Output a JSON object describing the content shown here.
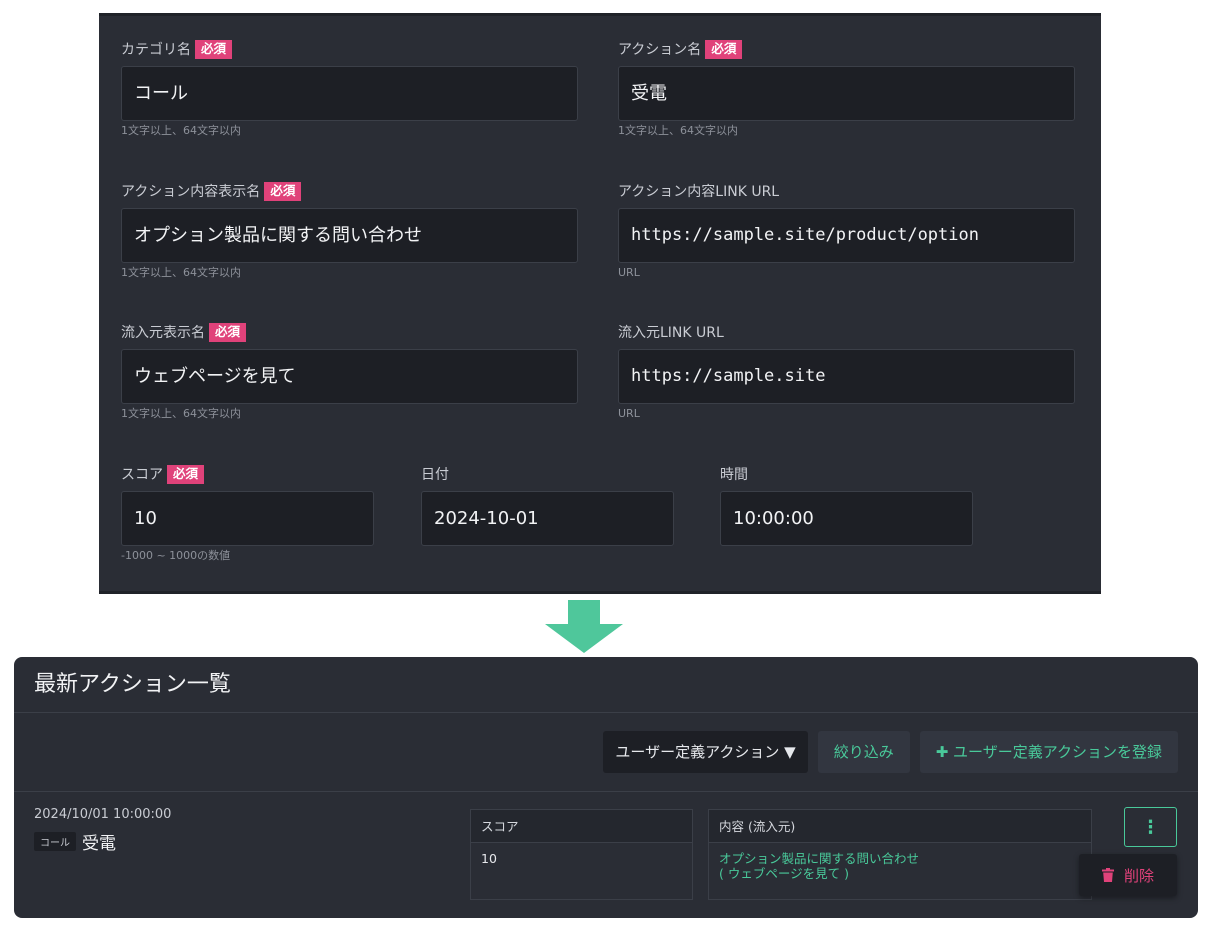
{
  "form": {
    "category": {
      "label": "カテゴリ名",
      "required": "必須",
      "value": "コール",
      "hint": "1文字以上、64文字以内"
    },
    "action": {
      "label": "アクション名",
      "required": "必須",
      "value": "受電",
      "hint": "1文字以上、64文字以内"
    },
    "content_name": {
      "label": "アクション内容表示名",
      "required": "必須",
      "value": "オプション製品に関する問い合わせ",
      "hint": "1文字以上、64文字以内"
    },
    "content_url": {
      "label": "アクション内容LINK URL",
      "value": "https://sample.site/product/option",
      "hint": "URL"
    },
    "source_name": {
      "label": "流入元表示名",
      "required": "必須",
      "value": "ウェブページを見て",
      "hint": "1文字以上、64文字以内"
    },
    "source_url": {
      "label": "流入元LINK URL",
      "value": "https://sample.site",
      "hint": "URL"
    },
    "score": {
      "label": "スコア",
      "required": "必須",
      "value": "10",
      "hint": "-1000 ~ 1000の数値"
    },
    "date": {
      "label": "日付",
      "value": "2024-10-01"
    },
    "time": {
      "label": "時間",
      "value": "10:00:00"
    }
  },
  "list": {
    "title": "最新アクション一覧",
    "filter_dropdown": "ユーザー定義アクション ▼",
    "filter_button": "絞り込み",
    "register_button": "✚ ユーザー定義アクションを登録",
    "row": {
      "datetime": "2024/10/01 10:00:00",
      "category_tag": "コール",
      "action": "受電",
      "score_header": "スコア",
      "score_value": "10",
      "content_header": "内容 (流入元)",
      "content_line1": "オプション製品に関する問い合わせ",
      "content_line2": "( ウェブページを見て )"
    },
    "menu_button": "⋮",
    "delete_label": "削除"
  },
  "colors": {
    "accent": "#49c99a",
    "required": "#e0427a",
    "panel": "#2a2d35",
    "arrow": "#4fc79b"
  }
}
